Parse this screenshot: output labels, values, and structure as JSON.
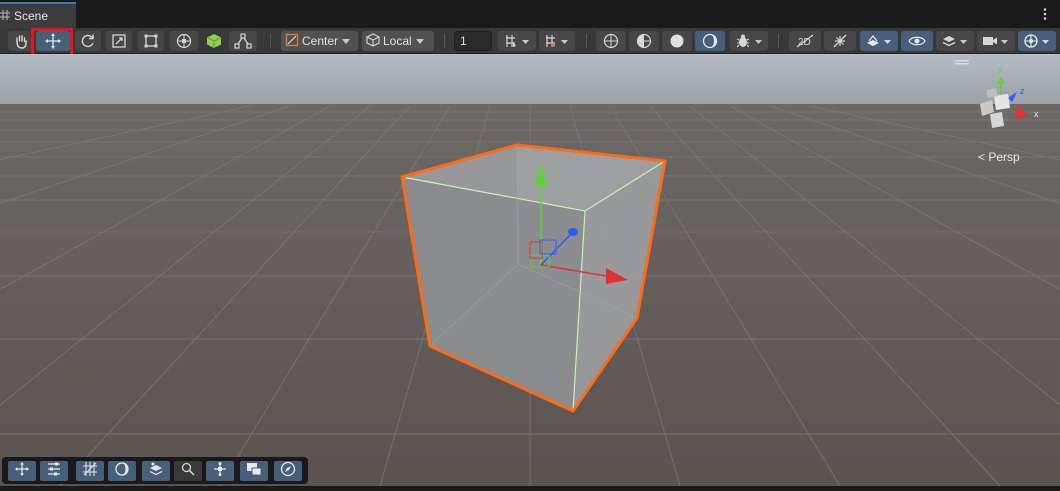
{
  "tab": {
    "title": "Scene"
  },
  "toolbar": {
    "pivot_mode": "Center",
    "pivot_rotation": "Local",
    "grid_snap_value": "1"
  },
  "view": {
    "projection": "Persp"
  },
  "colors": {
    "selection_outline": "#ff6a14",
    "active_tool": "#46607c",
    "x_axis": "#e23131",
    "y_axis": "#5ed13b",
    "z_axis": "#2b5bff",
    "highlight_box": "#e8141c"
  },
  "icons": [
    "hand-tool-icon",
    "move-tool-icon",
    "rotate-tool-icon",
    "scale-tool-icon",
    "rect-tool-icon",
    "transform-tool-icon",
    "custom-editor-tool-icon",
    "component-tool-icon",
    "pivot-center-icon",
    "pivot-local-icon",
    "grid-snap-icon",
    "increment-snap-icon",
    "wireframe-shading-icon",
    "shaded-wireframe-icon",
    "shaded-icon",
    "draw-mode-icon",
    "debug-icon",
    "2d-toggle-icon",
    "lighting-toggle-icon",
    "effects-icon",
    "visibility-icon",
    "layers-icon",
    "camera-icon",
    "gizmos-icon",
    "view-gizmo-icon"
  ]
}
